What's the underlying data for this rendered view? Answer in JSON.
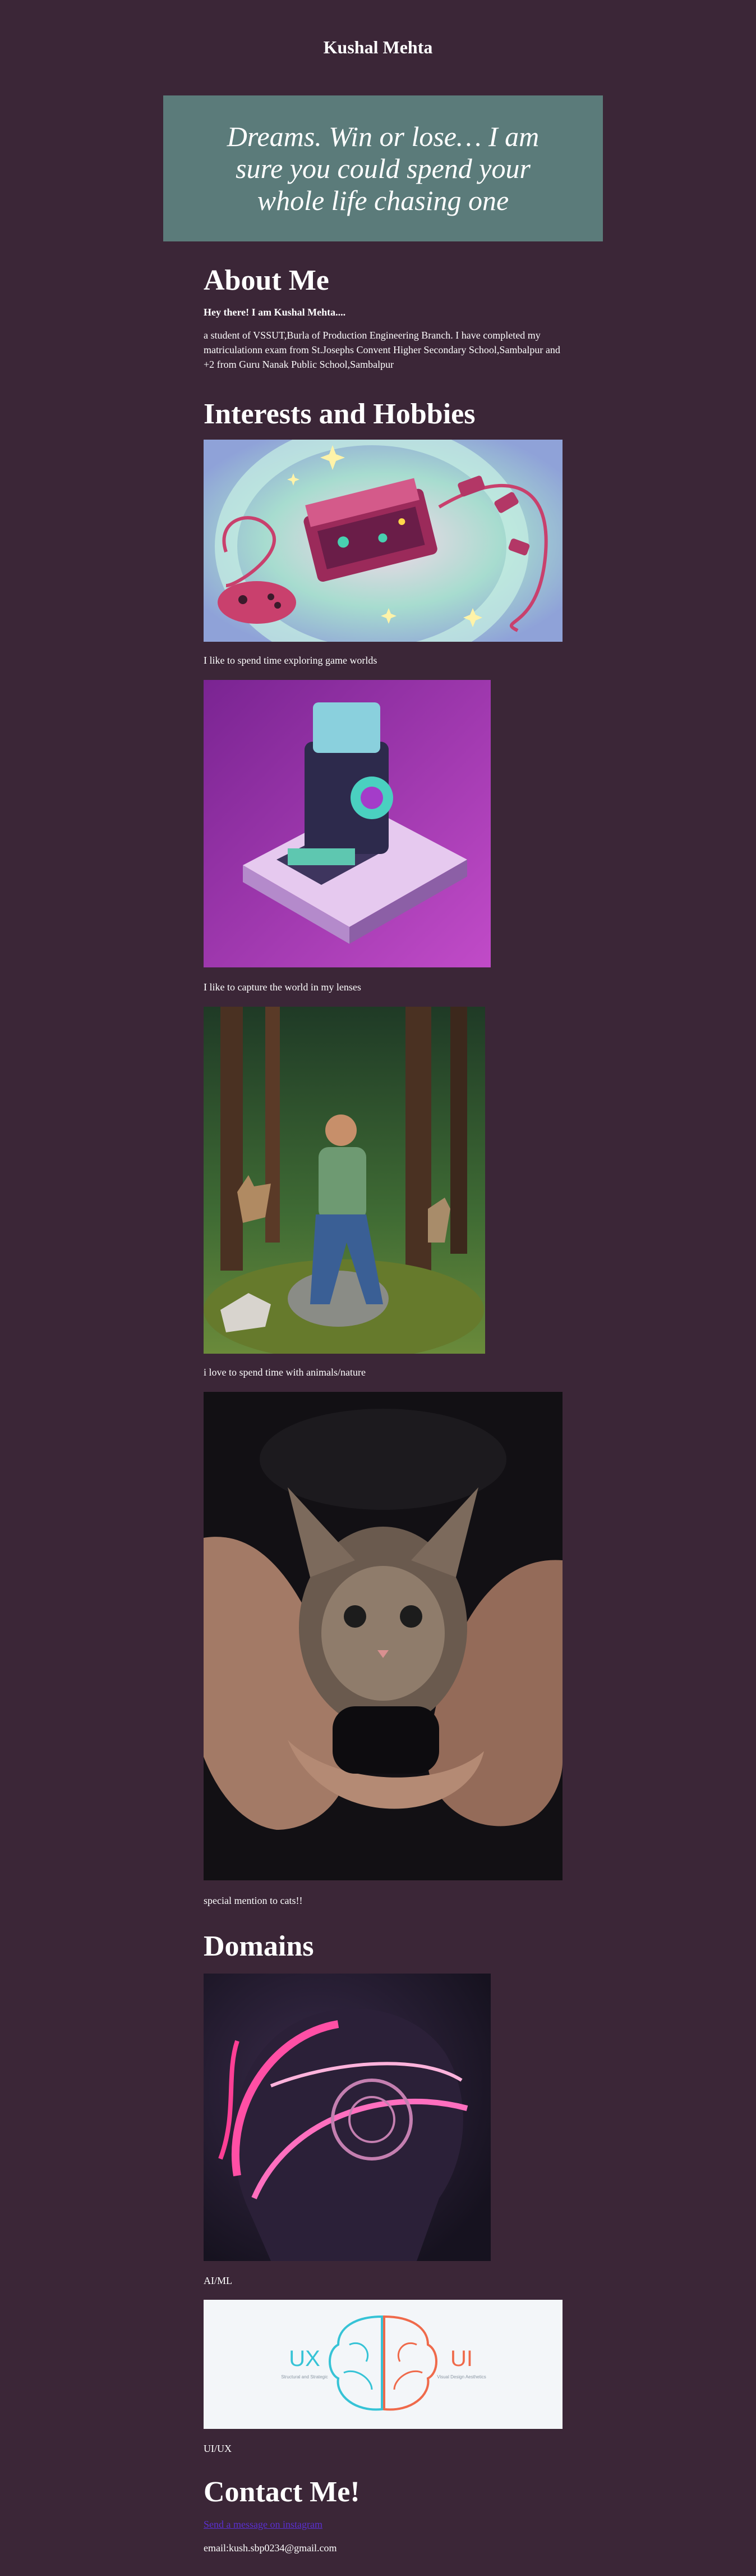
{
  "site": {
    "title": "Kushal Mehta"
  },
  "quote": {
    "text": "Dreams. Win or lose… I am sure you could spend your whole life chasing one"
  },
  "about": {
    "heading": "About Me",
    "greeting": "Hey there! I am Kushal Mehta....",
    "bio": "a student of VSSUT,Burla of Production Engineering Branch. I have completed my matriculationn exam from St.Josephs Convent Higher Secondary School,Sambalpur and +2 from Guru Nanak Public School,Sambalpur"
  },
  "interests": {
    "heading": "Interests and Hobbies",
    "items": [
      {
        "caption": "I like to spend time exploring game worlds",
        "icon": "gaming-console-illustration"
      },
      {
        "caption": "I like to capture the world in my lenses",
        "icon": "camera-illustration"
      },
      {
        "caption": "i love to spend time with animals/nature",
        "icon": "man-with-animals-photo"
      },
      {
        "caption": "special mention to cats!!",
        "icon": "kitten-in-hands-photo"
      }
    ]
  },
  "domains": {
    "heading": "Domains",
    "items": [
      {
        "caption": "AI/ML",
        "icon": "ai-head-illustration"
      },
      {
        "caption": "UI/UX",
        "icon": "ux-ui-brain-illustration",
        "left_word": "UX",
        "right_word": "UI",
        "left_sub": "Structural and Strategic",
        "right_sub": "Visual Design Aesthetics"
      }
    ]
  },
  "contact": {
    "heading": "Contact Me!",
    "link_text": "Send a message on instagram",
    "email": "email:kush.sbp0234@gmail.com"
  },
  "colors": {
    "background": "#3b2637",
    "quote_box": "#5b7b7a",
    "link": "#5a2fd0",
    "ux_cyan": "#36c3d6",
    "ui_orange": "#ef6a4b"
  }
}
